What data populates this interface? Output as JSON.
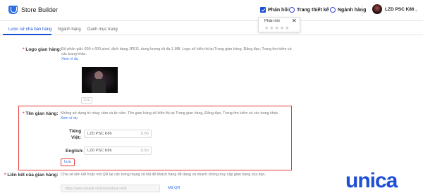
{
  "topbar": {
    "app_name": "Store Builder",
    "items": [
      {
        "label": "Phản hồi",
        "icon": "checkbox-icon"
      },
      {
        "label": "Trang thiết kế",
        "icon": "circle-icon"
      },
      {
        "label": "Ngành hàng",
        "icon": "circle-icon"
      }
    ],
    "user": "LZD PSC K86",
    "caret": "⌄"
  },
  "feedback_popup": {
    "title": "Phản hồi",
    "close": "✕",
    "stars": "★★★★★"
  },
  "tabs": [
    "Lược sử nhà bán hàng",
    "Ngành hàng",
    "Danh mục trang"
  ],
  "logo_section": {
    "label": "Logo gian hàng:",
    "hint_line1": "Độ phân giải: 600 x 600 pixel, định dạng JPEG, dung lượng tối đa 1 MB. Logo sẽ hiển thị tại Trang gian hàng, Đăng đạo, Trang tìm kiếm và",
    "hint_line2": "các trang khác.",
    "example_link": "Xem ví dụ",
    "save_label": "Lưu"
  },
  "name_section": {
    "label": "Tên gian hàng:",
    "hint": "Không sử dụng từ nhạy cảm và từ cấm. Tên gian hàng sẽ hiển thị tại Trang gian hàng, Đăng đạo, Trang tìm kiếm và các trang khác.",
    "example_link": "Xem ví dụ",
    "vi_label_1": "Tiếng",
    "vi_label_2": "Việt:",
    "vi_value": "LZD PSC K86",
    "vi_count": "11/50",
    "en_label": "English:",
    "en_value": "LZD PSC K86",
    "en_count": "11/50",
    "save_label": "Lưu"
  },
  "link_section": {
    "label": "Liên kết của gian hàng:",
    "hint": "Chia sẻ liên kết hoặc mã QR tại các trang mạng xã hội để khách hàng dễ dàng và nhanh chóng truy cập gian hàng của bạn.",
    "url_value": "https://www.lazada.vn/shop/lzd-psc-k86",
    "qr_label": "Mã QR"
  },
  "watermark": {
    "text": "unica",
    "brand_color": "#1f4fd6",
    "dot_color": "#e53935"
  },
  "colors": {
    "accent": "#1a4fd6",
    "highlight": "#e53935"
  }
}
